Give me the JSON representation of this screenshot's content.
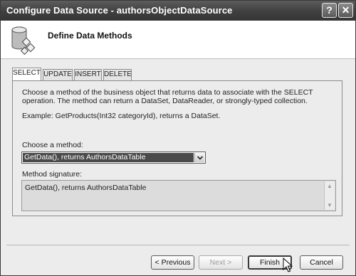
{
  "window": {
    "title": "Configure Data Source - authorsObjectDataSource"
  },
  "titlebar_buttons": {
    "help_label": "?",
    "close_label": "✕"
  },
  "header": {
    "heading": "Define Data Methods",
    "icon": "database-icon"
  },
  "tabs": [
    {
      "label": "SELECT",
      "active": true
    },
    {
      "label": "UPDATE",
      "active": false
    },
    {
      "label": "INSERT",
      "active": false
    },
    {
      "label": "DELETE",
      "active": false
    }
  ],
  "select_tab": {
    "description": "Choose a method of the business object that returns data to associate with the SELECT operation. The method can return a DataSet, DataReader, or strongly-typed collection.",
    "example": "Example: GetProducts(Int32 categoryId), returns a DataSet.",
    "choose_method_label": "Choose a method:",
    "method_selected": "GetData(), returns AuthorsDataTable",
    "signature_label": "Method signature:",
    "signature_value": "GetData(), returns AuthorsDataTable"
  },
  "buttons": {
    "previous": "< Previous",
    "next": "Next >",
    "finish": "Finish",
    "cancel": "Cancel"
  }
}
